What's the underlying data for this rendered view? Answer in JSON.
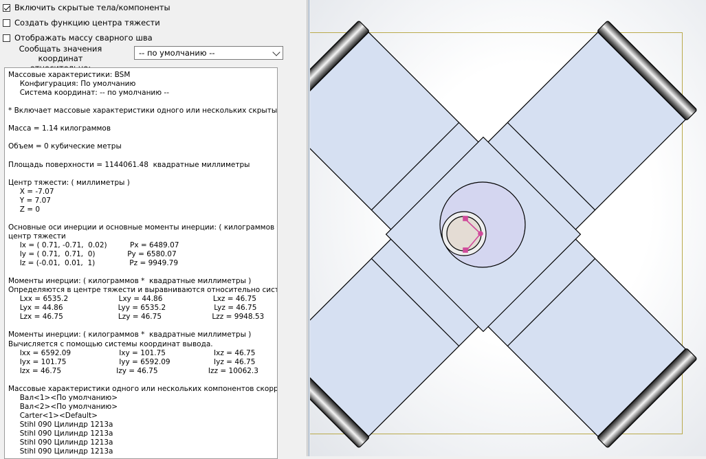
{
  "options": {
    "include_hidden": {
      "label": "Включить скрытые тела/компоненты",
      "checked": true
    },
    "create_cog": {
      "label": "Создать функцию центра тяжести",
      "checked": false
    },
    "show_weld_mass": {
      "label": "Отображать массу сварного шва",
      "checked": false
    }
  },
  "coord_label_line1": "Сообщать значения координат",
  "coord_label_line2": "относительно:",
  "coord_select_value": "-- по умолчанию --",
  "report_lines": [
    "Массовые характеристики: BSM",
    "     Конфигурация: По умолчанию",
    "     Система координат: -- по умолчанию --",
    "",
    "* Включает массовые характеристики одного или нескольких скрытых ко",
    "",
    "Масса = 1.14 килограммов",
    "",
    "Объем = 0 кубические метры",
    "",
    "Площадь поверхности = 1144061.48  квадратные миллиметры",
    "",
    "Центр тяжести: ( миллиметры )",
    "     X = -7.07",
    "     Y = 7.07",
    "     Z = 0",
    "",
    "Основные оси инерции и основные моменты инерции: ( килограммов *",
    "центр тяжести",
    "     Ix = ( 0.71, -0.71,  0.02)          Px = 6489.07",
    "     Iy = ( 0.71,  0.71,  0)              Py = 6580.07",
    "     Iz = (-0.01,  0.01,  1)               Pz = 9949.79",
    "",
    "Моменты инерции: ( килограммов *  квадратные миллиметры )",
    "Определяются в центре тяжести и выравниваются относительно системы",
    "     Lxx = 6535.2                      Lxy = 44.86                      Lxz = 46.75",
    "     Lyx = 44.86                        Lyy = 6535.2                     Lyz = 46.75",
    "     Lzx = 46.75                        Lzy = 46.75                      Lzz = 9948.53",
    "",
    "Моменты инерции: ( килограммов *  квадратные миллиметры )",
    "Вычисляется с помощью системы координат вывода.",
    "     Ixx = 6592.09                     Ixy = 101.75                     Ixz = 46.75",
    "     Iyx = 101.75                       Iyy = 6592.09                   Iyz = 46.75",
    "     Izx = 46.75                        Izy = 46.75                      Izz = 10062.3",
    "",
    "Массовые характеристики одного или нескольких компонентов скоррек",
    "     Вал<1><По умолчанию>",
    "     Вал<2><По умолчанию>",
    "     Carter<1><Default>",
    "     Stihl 090 Цилиндр 1213a",
    "     Stihl 090 Цилиндр 1213a",
    "     Stihl 090 Цилиндр 1213a",
    "     Stihl 090 Цилиндр 1213a"
  ],
  "colors": {
    "part_fill": "#d6e0f2",
    "hub_fill": "#d4d6f0",
    "edge": "#000000",
    "triad": "#d04a9a"
  }
}
